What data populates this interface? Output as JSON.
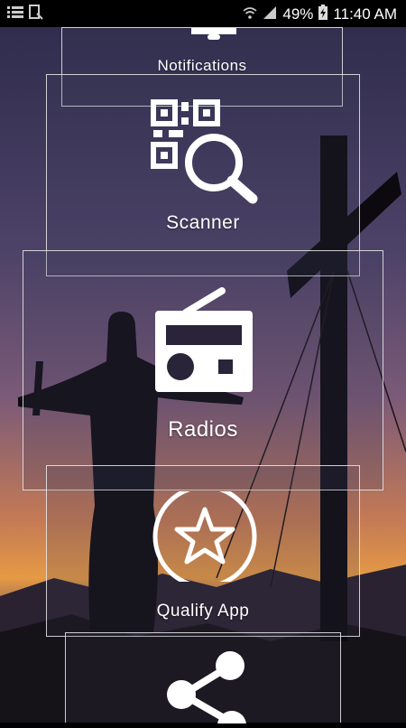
{
  "status_bar": {
    "battery_percent": "49%",
    "time": "11:40 AM",
    "icons": [
      "menu-icon",
      "download-icon",
      "wifi-icon",
      "signal-icon",
      "battery-charging-icon"
    ]
  },
  "menu": {
    "items": [
      {
        "label": "Notifications",
        "icon": "notification-bell-icon"
      },
      {
        "label": "Scanner",
        "icon": "qr-scanner-icon"
      },
      {
        "label": "Radios",
        "icon": "radio-icon"
      },
      {
        "label": "Qualify App",
        "icon": "star-icon"
      },
      {
        "label": "",
        "icon": "share-icon"
      }
    ]
  },
  "colors": {
    "text": "#ffffff",
    "card_border": "#ebebeb",
    "status_bar_bg": "#000000"
  }
}
